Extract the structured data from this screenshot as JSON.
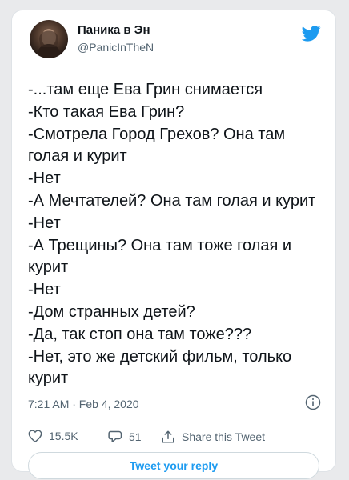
{
  "user": {
    "name": "Паника в Эн",
    "handle": "@PanicInTheN"
  },
  "tweet": {
    "text": "-...там еще Ева Грин снимается\n-Кто такая Ева Грин?\n-Смотрела Город Грехов? Она там голая и курит\n-Нет\n-А Мечтателей? Она там голая и курит\n-Нет\n-А Трещины? Она там тоже голая и курит\n-Нет\n-Дом странных детей?\n-Да, так стоп она там тоже???\n-Нет, это же детский фильм, только курит",
    "timestamp": "7:21 AM · Feb 4, 2020"
  },
  "actions": {
    "likes": "15.5K",
    "replies": "51",
    "share_label": "Share this Tweet"
  },
  "reply_button": {
    "label": "Tweet your reply"
  },
  "colors": {
    "accent": "#1d9bf0",
    "secondary_text": "#536471",
    "border": "#cfd9de"
  },
  "icons": [
    "twitter-bird-icon",
    "info-icon",
    "heart-icon",
    "reply-icon",
    "share-icon"
  ]
}
